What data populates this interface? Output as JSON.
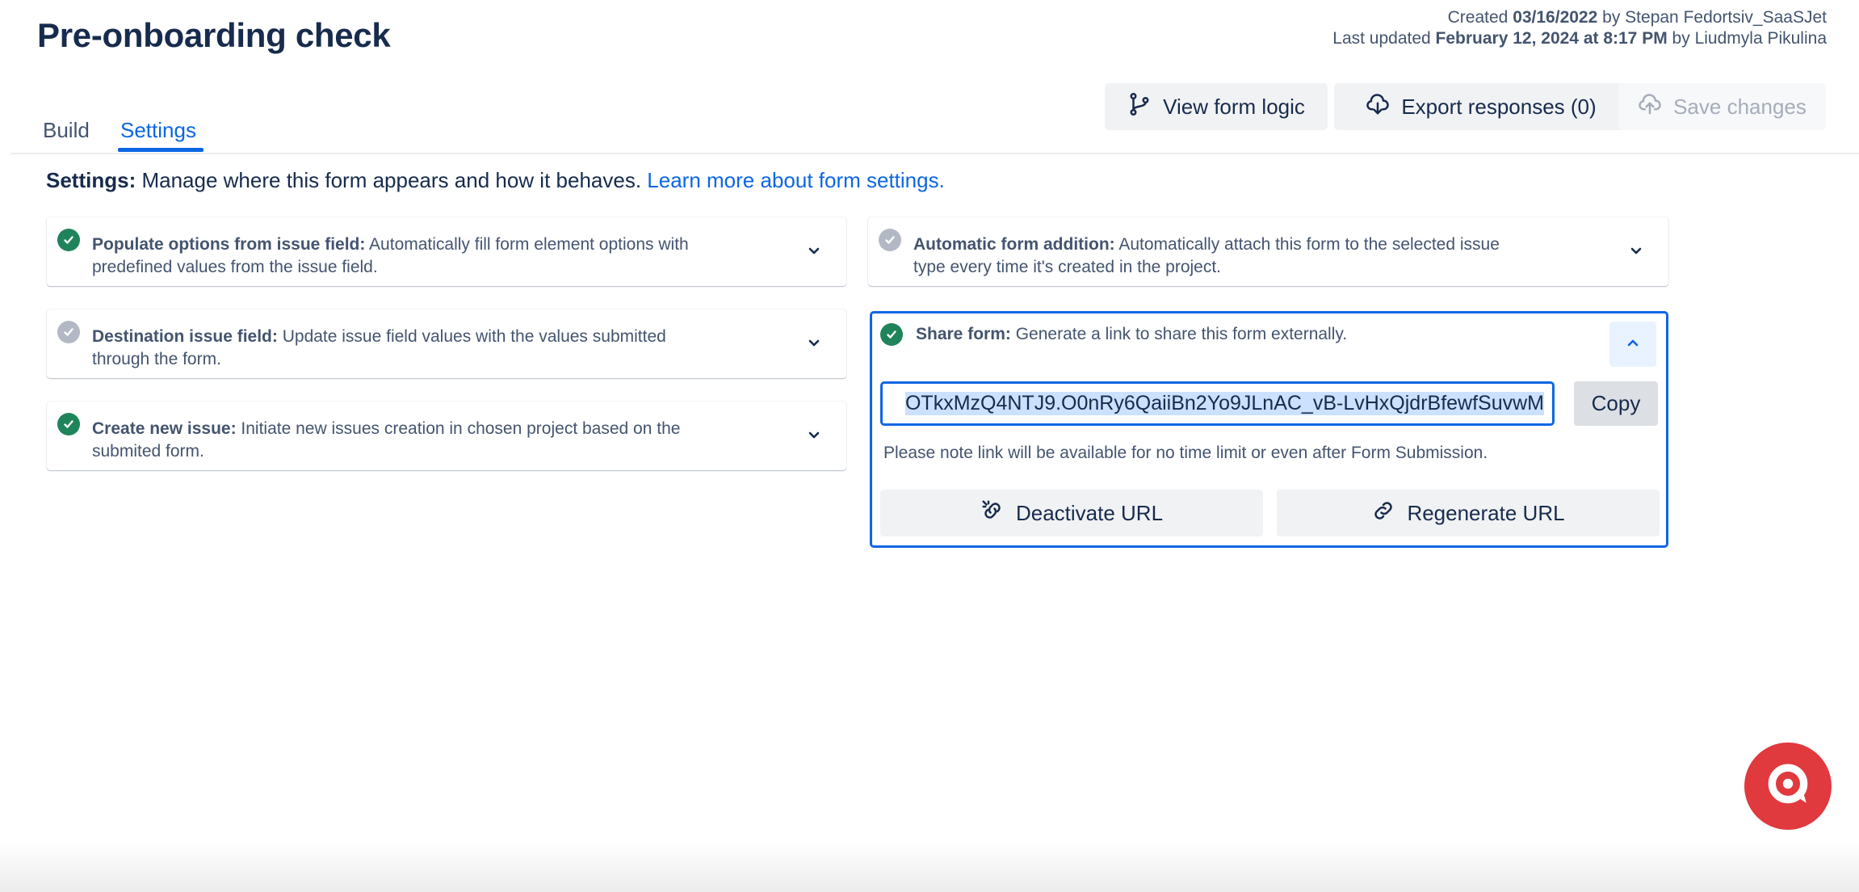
{
  "header": {
    "title": "Pre-onboarding check",
    "created_prefix": "Created",
    "created_date": "03/16/2022",
    "created_by_prefix": "by",
    "created_by": "Stepan Fedortsiv_SaaSJet",
    "updated_prefix": "Last updated",
    "updated_date": "February 12, 2024 at 8:17 PM",
    "updated_by_prefix": "by",
    "updated_by": "Liudmyla Pikulina"
  },
  "tabs": [
    {
      "label": "Build",
      "active": false
    },
    {
      "label": "Settings",
      "active": true
    }
  ],
  "toolbar": {
    "view_logic_label": "View form logic",
    "export_label": "Export responses (0)",
    "save_label": "Save changes"
  },
  "intro": {
    "bold": "Settings:",
    "text": "Manage where this form appears and how it behaves.",
    "link": "Learn more about form settings."
  },
  "settings": {
    "populate": {
      "title": "Populate options from issue field:",
      "desc": "Automatically fill form element options with",
      "desc2": "predefined values from the issue field.",
      "enabled": true
    },
    "destination": {
      "title": "Destination issue field:",
      "desc": "Update issue field values with the values submitted",
      "desc2": "through the form.",
      "enabled": false
    },
    "create_issue": {
      "title": "Create new issue:",
      "desc": "Initiate new issues creation in chosen project based on the",
      "desc2": "submited form.",
      "enabled": true
    },
    "auto_add": {
      "title": "Automatic form addition:",
      "desc": "Automatically attach this form to the selected issue",
      "desc2": "type every time it's created in the project.",
      "enabled": false
    },
    "share": {
      "title": "Share form:",
      "desc": "Generate a link to share this form externally.",
      "enabled": true,
      "url_value": "OTkxMzQ4NTJ9.O0nRy6QaiiBn2Yo9JLnAC_vB-LvHxQjdrBfewfSuvwM",
      "copy_label": "Copy",
      "note": "Please note link will be available for no time limit or even after Form Submission.",
      "deactivate_label": "Deactivate URL",
      "regenerate_label": "Regenerate URL"
    }
  },
  "colors": {
    "accent": "#0C66E4",
    "enabled_status": "#1F845A",
    "disabled_status": "#B3B9C4",
    "chat_widget": "#E0393E"
  },
  "icons": {
    "view_logic": "git-branch-icon",
    "export": "cloud-download-icon",
    "save": "cloud-upload-icon",
    "check": "check-icon",
    "expand": "chevron-down-icon",
    "collapse": "chevron-up-icon",
    "deactivate": "link-broken-icon",
    "regenerate": "link-icon",
    "chat": "chat-icon"
  }
}
